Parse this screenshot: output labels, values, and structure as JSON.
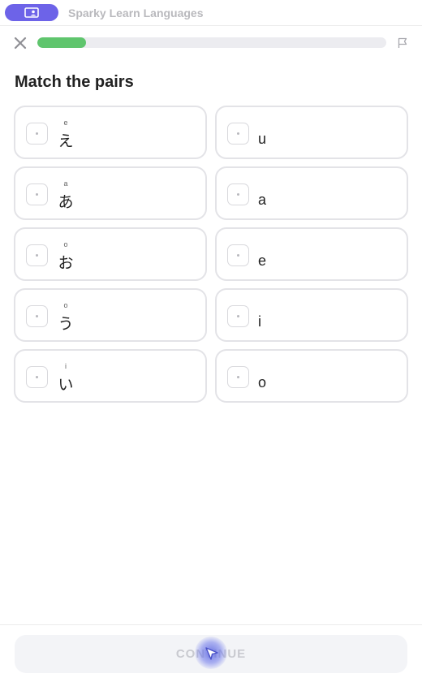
{
  "app": {
    "name": "Sparky Learn Languages",
    "accent": "#6d63e8"
  },
  "lesson": {
    "progress": 0.14,
    "progress_color": "#5fc56d"
  },
  "prompt": "Match the pairs",
  "left_cards": [
    {
      "ruby": "e",
      "kana": "え"
    },
    {
      "ruby": "a",
      "kana": "あ"
    },
    {
      "ruby": "o",
      "kana": "お"
    },
    {
      "ruby": "o",
      "kana": "う"
    },
    {
      "ruby": "i",
      "kana": "い"
    }
  ],
  "right_cards": [
    {
      "label": "u"
    },
    {
      "label": "a"
    },
    {
      "label": "e"
    },
    {
      "label": "i"
    },
    {
      "label": "o"
    }
  ],
  "footer": {
    "continue_label": "CONTINUE"
  },
  "icons": {
    "close": "close-icon",
    "flag": "flag-icon",
    "app": "app-window-icon",
    "cursor": "cursor-icon"
  }
}
